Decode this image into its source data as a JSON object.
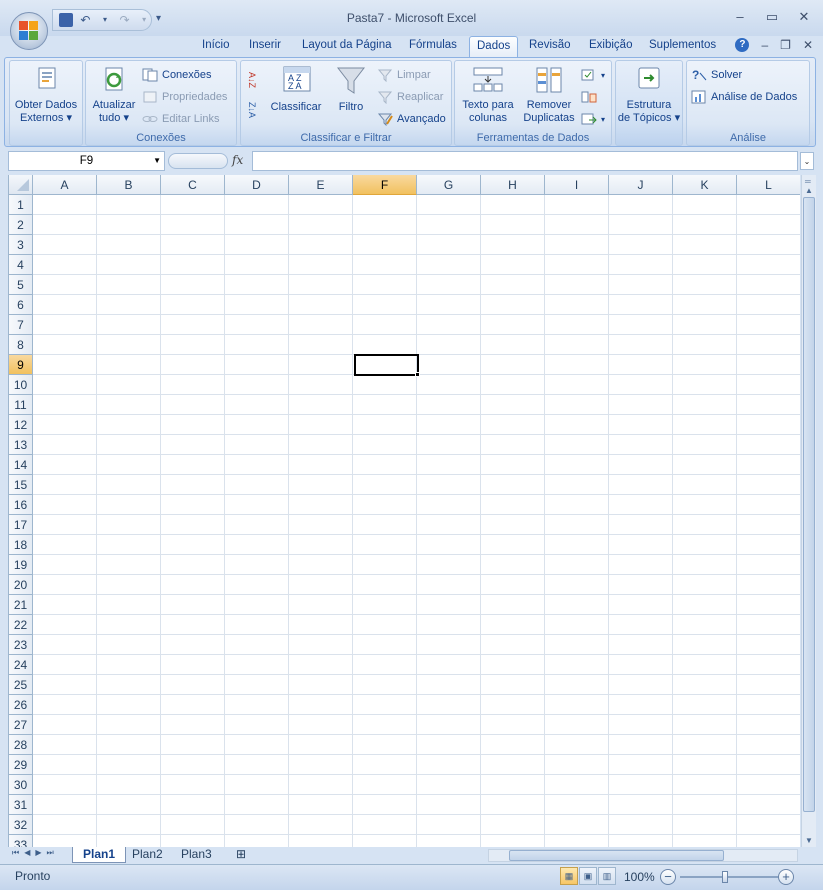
{
  "window": {
    "title": "Pasta7 - Microsoft Excel",
    "min_glyph": "–",
    "max_glyph": "▭",
    "close_glyph": "✕"
  },
  "qat": {
    "save_icon": "💾",
    "undo_icon": "↶",
    "redo_icon": "↷",
    "more_glyph": "▾"
  },
  "tabs": [
    "Início",
    "Inserir",
    "Layout da Página",
    "Fórmulas",
    "Dados",
    "Revisão",
    "Exibição",
    "Suplementos"
  ],
  "ribbon_controls": {
    "help": "?",
    "min": "–",
    "restore": "❐",
    "close": "✕"
  },
  "ribbon": {
    "obter": {
      "line1": "Obter Dados",
      "line2": "Externos ▾"
    },
    "conexoes": {
      "atualizar_line1": "Atualizar",
      "atualizar_line2": "tudo ▾",
      "conexoes": "Conexões",
      "propriedades": "Propriedades",
      "editar_links": "Editar Links",
      "label": "Conexões"
    },
    "classificar": {
      "az": "A↓Z",
      "za": "Z↓A",
      "classificar": "Classificar",
      "filtro": "Filtro",
      "limpar": "Limpar",
      "reaplicar": "Reaplicar",
      "avancado": "Avançado",
      "label": "Classificar e Filtrar"
    },
    "ferramentas": {
      "texto_line1": "Texto para",
      "texto_line2": "colunas",
      "remover_line1": "Remover",
      "remover_line2": "Duplicatas",
      "label": "Ferramentas de Dados"
    },
    "estrutura": {
      "line1": "Estrutura",
      "line2": "de Tópicos ▾"
    },
    "analise": {
      "solver": "Solver",
      "analise_dados": "Análise de Dados",
      "label": "Análise"
    }
  },
  "formula_bar": {
    "name_box": "F9",
    "fx": "fx",
    "formula": ""
  },
  "grid": {
    "columns": [
      "A",
      "B",
      "C",
      "D",
      "E",
      "F",
      "G",
      "H",
      "I",
      "J",
      "K",
      "L"
    ],
    "selected_column": "F",
    "rows": [
      "1",
      "2",
      "3",
      "4",
      "5",
      "6",
      "7",
      "8",
      "9",
      "10",
      "11",
      "12",
      "13",
      "14",
      "15",
      "16",
      "17",
      "18",
      "19",
      "20",
      "21",
      "22",
      "23",
      "24",
      "25",
      "26",
      "27",
      "28",
      "29",
      "30",
      "31",
      "32",
      "33"
    ],
    "selected_row": "9",
    "active_cell": "F9"
  },
  "sheets": {
    "tabs": [
      "Plan1",
      "Plan2",
      "Plan3"
    ],
    "active": "Plan1",
    "nav_first": "⏮",
    "nav_prev": "◀",
    "nav_next": "▶",
    "nav_last": "⏭"
  },
  "status": {
    "text": "Pronto",
    "zoom": "100%",
    "zoom_minus": "−",
    "zoom_plus": "+"
  }
}
